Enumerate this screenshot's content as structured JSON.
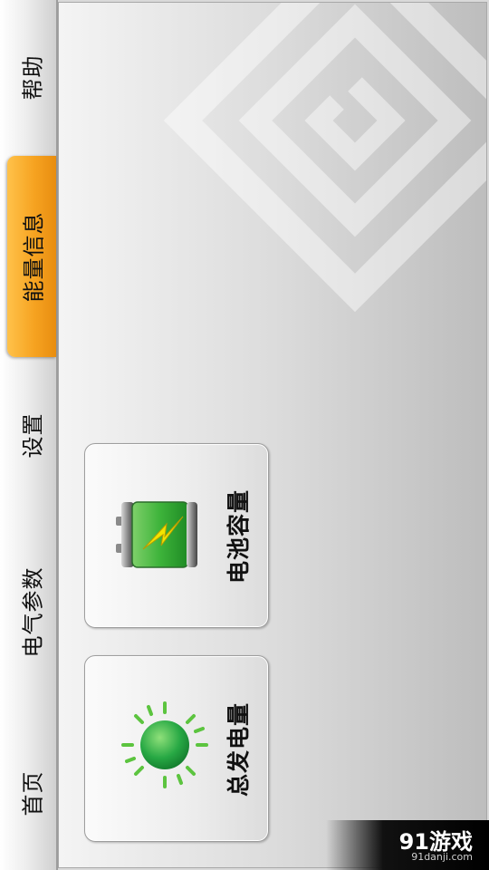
{
  "tabs": [
    {
      "label": "帮助",
      "active": false
    },
    {
      "label": "能量信息",
      "active": true
    },
    {
      "label": "设置",
      "active": false
    },
    {
      "label": "电气参数",
      "active": false
    },
    {
      "label": "首页",
      "active": false
    }
  ],
  "tiles": [
    {
      "label": "电池容量",
      "icon": "battery-charging-icon"
    },
    {
      "label": "总发电量",
      "icon": "sun-icon"
    }
  ],
  "watermark": {
    "brand": "91游戏",
    "url": "91danji.com"
  },
  "colors": {
    "active_tab": "#f6a321",
    "battery_green": "#3db33a",
    "bolt_yellow": "#f2e400",
    "sun_green": "#27a844"
  }
}
